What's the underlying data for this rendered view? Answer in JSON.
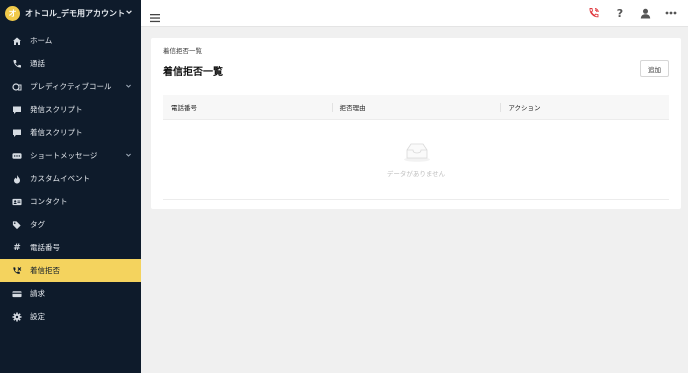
{
  "account": {
    "name": "オトコル_デモ用アカウント",
    "logo_text": "オ"
  },
  "sidebar": {
    "items": [
      {
        "label": "ホーム",
        "icon": "home-icon",
        "has_sub": false,
        "active": false
      },
      {
        "label": "通話",
        "icon": "phone-icon",
        "has_sub": false,
        "active": false
      },
      {
        "label": "プレディクティブコール",
        "icon": "predictive-call-icon",
        "has_sub": true,
        "active": false
      },
      {
        "label": "発信スクリプト",
        "icon": "comment-icon",
        "has_sub": false,
        "active": false
      },
      {
        "label": "着信スクリプト",
        "icon": "comment-icon",
        "has_sub": false,
        "active": false
      },
      {
        "label": "ショートメッセージ",
        "icon": "sms-icon",
        "has_sub": true,
        "active": false
      },
      {
        "label": "カスタムイベント",
        "icon": "fire-icon",
        "has_sub": false,
        "active": false
      },
      {
        "label": "コンタクト",
        "icon": "contact-card-icon",
        "has_sub": false,
        "active": false
      },
      {
        "label": "タグ",
        "icon": "tags-icon",
        "has_sub": false,
        "active": false
      },
      {
        "label": "電話番号",
        "icon": "hash-icon",
        "has_sub": false,
        "active": false
      },
      {
        "label": "着信拒否",
        "icon": "phone-blocked-icon",
        "has_sub": false,
        "active": true
      },
      {
        "label": "請求",
        "icon": "credit-card-icon",
        "has_sub": false,
        "active": false
      },
      {
        "label": "設定",
        "icon": "gear-icon",
        "has_sub": false,
        "active": false
      }
    ]
  },
  "topbar": {
    "icons": [
      "menu-icon",
      "phone-call-icon",
      "help-icon",
      "user-icon",
      "more-icon"
    ],
    "phone_color": "#e0383e"
  },
  "page": {
    "breadcrumb": "着信拒否一覧",
    "title": "着信拒否一覧",
    "add_label": "追加",
    "columns": [
      "電話番号",
      "拒否理由",
      "アクション"
    ],
    "empty_text": "データがありません"
  },
  "colors": {
    "sidebar_bg": "#0e1b2b",
    "active_bg": "#f4d35e",
    "accent_logo": "#f0c94a"
  }
}
